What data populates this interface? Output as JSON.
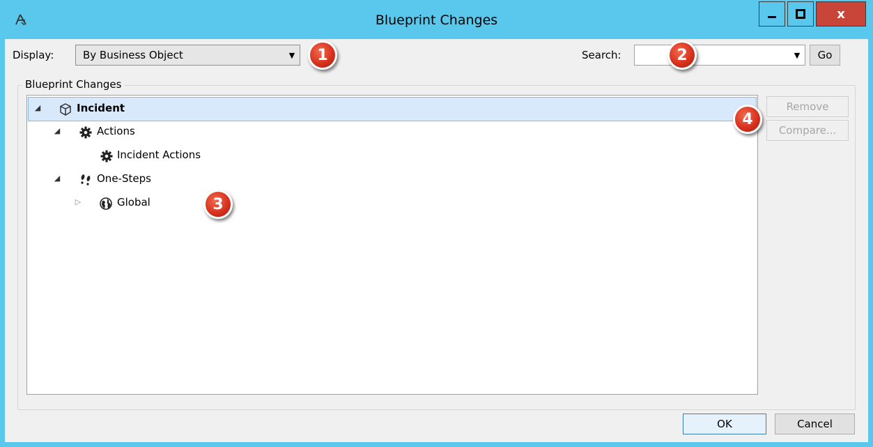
{
  "window": {
    "title": "Blueprint Changes",
    "close_glyph": "x",
    "accent_color": "#5ac8ec",
    "close_color": "#c9453a"
  },
  "toolbar": {
    "display_label": "Display:",
    "display_value": "By Business Object",
    "search_label": "Search:",
    "search_value": "",
    "go_label": "Go"
  },
  "group": {
    "label": "Blueprint Changes"
  },
  "tree": [
    {
      "label": "Incident",
      "icon": "cube-icon",
      "expanded": true,
      "selected": true
    },
    {
      "label": "Actions",
      "icon": "gear-icon",
      "expanded": true
    },
    {
      "label": "Incident Actions",
      "icon": "gear-icon"
    },
    {
      "label": "One-Steps",
      "icon": "footsteps-icon",
      "expanded": true
    },
    {
      "label": "Global",
      "icon": "globe-icon",
      "expanded": false
    }
  ],
  "side_buttons": {
    "remove_label": "Remove",
    "compare_label": "Compare..."
  },
  "footer": {
    "ok_label": "OK",
    "cancel_label": "Cancel"
  },
  "callouts": [
    "1",
    "2",
    "3",
    "4"
  ],
  "expander_glyphs": {
    "expanded": "◢",
    "collapsed": "▷"
  },
  "combo_arrow": "▼"
}
